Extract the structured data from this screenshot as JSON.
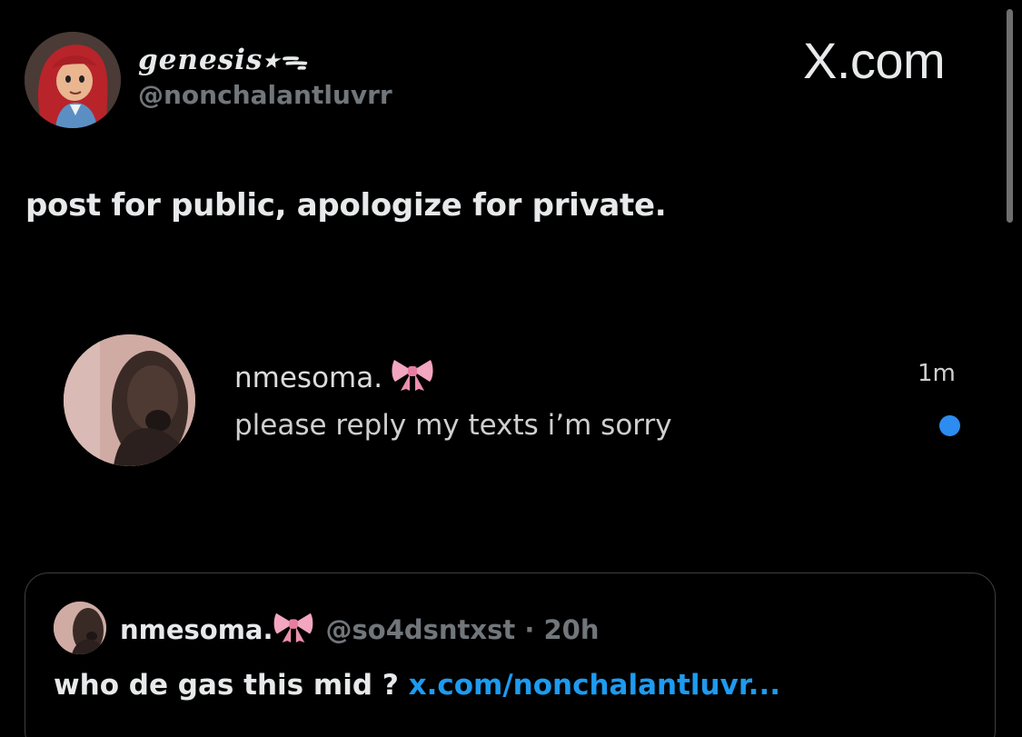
{
  "header": {
    "display_name": "genesis⭑ᯓ",
    "username": "@nonchalantluvrr",
    "site_label": "X.com"
  },
  "tweet": {
    "text": "post for public, apologize for private."
  },
  "dm_notification": {
    "name": "nmesoma.",
    "message": "please reply my texts i’m sorry",
    "time": "1m",
    "unread_dot_color": "#2d8cf0"
  },
  "quoted_tweet": {
    "name": "nmesoma.",
    "handle": "@so4dsntxst · 20h",
    "text": "who de gas this mid ?",
    "link_text": "x.com/nonchalantluvr..."
  },
  "icons": {
    "bow": "pink-bow-emoji"
  }
}
